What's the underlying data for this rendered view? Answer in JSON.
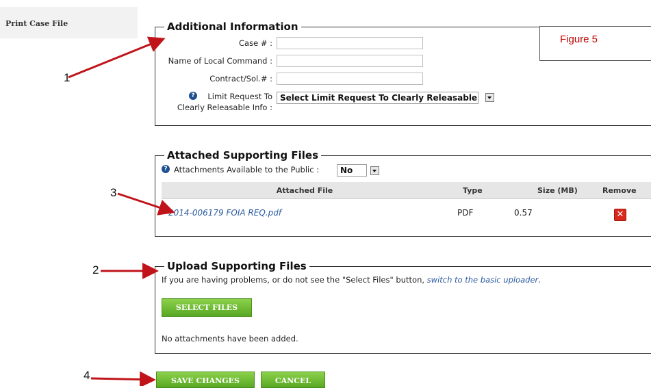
{
  "sidebar": {
    "print_case_file": "Print Case File"
  },
  "annotations": {
    "figure": "Figure 5",
    "n1": "1",
    "n2": "2",
    "n3": "3",
    "n4": "4",
    "arrow_color": "#c0141a"
  },
  "additional_info": {
    "legend": "Additional Information",
    "case_label": "Case # :",
    "case_value": "",
    "command_label": "Name of Local Command :",
    "command_value": "",
    "contract_label": "Contract/Sol.# :",
    "contract_value": "",
    "limit_label_line1": "Limit Request To",
    "limit_label_line2": "Clearly Releasable Info :",
    "limit_select": "Select Limit Request To Clearly Releasable Info"
  },
  "attached": {
    "legend": "Attached Supporting Files",
    "public_label": "Attachments Available to the Public :",
    "public_value": "No",
    "columns": [
      "Attached File",
      "Type",
      "Size (MB)",
      "Remove"
    ],
    "rows": [
      {
        "file": "2014-006179 FOIA REQ.pdf",
        "type": "PDF",
        "size": "0.57"
      }
    ]
  },
  "upload": {
    "legend": "Upload Supporting Files",
    "help_text": "If you are having problems, or do not see the \"Select Files\" button,",
    "help_link": "switch to the basic uploader",
    "help_end": ".",
    "select_files": "SELECT FILES",
    "empty_text": "No attachments have been added."
  },
  "actions": {
    "save": "SAVE CHANGES",
    "cancel": "CANCEL"
  },
  "colors": {
    "accent_green": "#58a824",
    "link": "#2a5aa0",
    "remove_red": "#d8291c"
  }
}
